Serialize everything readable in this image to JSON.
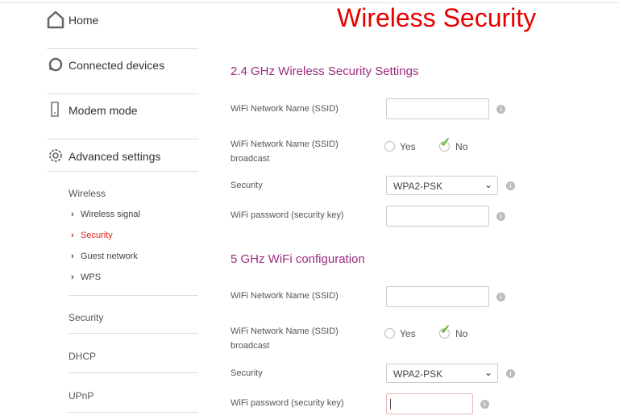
{
  "page_title": "Wireless Security",
  "sidebar": {
    "items": [
      {
        "label": "Home",
        "icon": "home-icon"
      },
      {
        "label": "Connected devices",
        "icon": "devices-icon"
      },
      {
        "label": "Modem mode",
        "icon": "modem-icon"
      },
      {
        "label": "Advanced settings",
        "icon": "gear-icon"
      }
    ],
    "section_label": "Wireless",
    "sub_items": [
      {
        "label": "Wireless signal"
      },
      {
        "label": "Security",
        "active": true
      },
      {
        "label": "Guest network"
      },
      {
        "label": "WPS"
      }
    ],
    "sections": [
      {
        "label": "Security"
      },
      {
        "label": "DHCP"
      },
      {
        "label": "UPnP"
      }
    ]
  },
  "band24": {
    "title": "2.4 GHz Wireless Security Settings",
    "ssid_label": "WiFi Network Name (SSID)",
    "ssid_value": "",
    "broadcast_label": "WiFi Network Name (SSID) broadcast",
    "yes": "Yes",
    "no": "No",
    "broadcast_selected": "No",
    "security_label": "Security",
    "security_value": "WPA2-PSK",
    "password_label": "WiFi password (security key)",
    "password_value": ""
  },
  "band5": {
    "title": "5 GHz WiFi configuration",
    "ssid_label": "WiFi Network Name (SSID)",
    "ssid_value": "",
    "broadcast_label": "WiFi Network Name (SSID) broadcast",
    "yes": "Yes",
    "no": "No",
    "broadcast_selected": "No",
    "security_label": "Security",
    "security_value": "WPA2-PSK",
    "password_label": "WiFi password (security key)",
    "password_value": ""
  },
  "colors": {
    "title": "#e60000",
    "section": "#9c2a80",
    "active": "#e2231a",
    "check": "#5cb82c"
  }
}
